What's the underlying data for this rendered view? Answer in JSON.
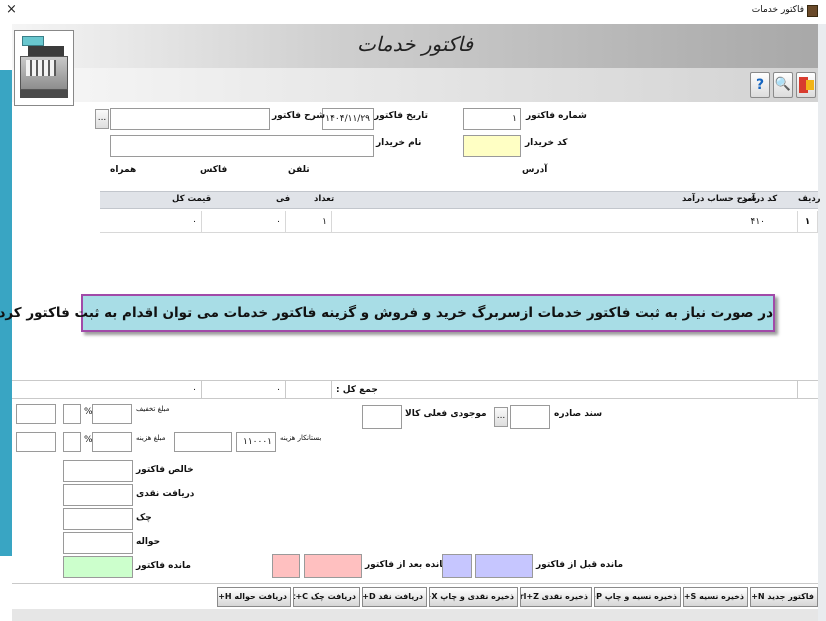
{
  "window": {
    "title": "فاکتور خدمات",
    "close_glyph": "×"
  },
  "header": {
    "title": "فاکتور خدمات"
  },
  "toolbar": {
    "help_glyph": "?",
    "search_glyph": "🔍"
  },
  "form": {
    "invoice_number_label": "شماره فاکتور",
    "invoice_number_value": "۱",
    "invoice_date_label": "تاریخ فاکتور",
    "invoice_date_value": "۱۴۰۴/۱۱/۲۹",
    "invoice_desc_label": "شرح فاکتور",
    "invoice_desc_value": "",
    "buyer_code_label": "کد خریدار",
    "buyer_code_value": "",
    "buyer_name_label": "نام خریدار",
    "buyer_name_value": "",
    "address_label": "آدرس",
    "phone_label": "تلفن",
    "fax_label": "فاکس",
    "mobile_label": "همراه",
    "browse_glyph": "..."
  },
  "grid": {
    "headers": {
      "row": "ردیف",
      "income_code": "کد درآمد",
      "income_desc": "شرح حساب درآمد",
      "qty": "تعداد",
      "unit_price": "فی",
      "total_price": "قیمت کل"
    },
    "rows": [
      {
        "row": "۱",
        "income_code": "۴۱۰",
        "qty": "۱",
        "unit_price": "۰",
        "total_price": "۰"
      }
    ]
  },
  "banner": "در صورت نیاز به ثبت فاکتور خدمات ازسربرگ خرید و فروش و گزینه فاکتور خدمات می توان اقدام به ثبت فاکتور کرد.",
  "totals": {
    "label": "جمع کل :",
    "total_price": "۰",
    "unit_price": "۰"
  },
  "summary": {
    "issued_doc_label": "سند صادره",
    "stock_label": "موجودی فعلی کالا",
    "discount_label": "مبلغ تخفیف",
    "expense_label": "مبلغ هزینه",
    "creditor_label": "بستانکار هزینه",
    "creditor_value": "۱۱۰۰۰۱",
    "percent_sign": "%",
    "net_invoice_label": "خالص فاکتور",
    "cash_received_label": "دریافت نقدی",
    "cheque_label": "چک",
    "draft_label": "حواله",
    "invoice_balance_label": "مانده فاکتور",
    "balance_after_label": "مانده بعد از فاکتور",
    "balance_before_label": "مانده قبل از فاکتور"
  },
  "buttons": {
    "new_invoice": "فاکتور جدید Ctrl+N",
    "save_credit": "ذخیره نسیه Ctrl+S",
    "save_credit_print": "ذخیره نسیه و چاپ Ctrl+P",
    "save_cash": "ذخیره نقدی Ctrl+Z",
    "save_cash_print": "ذخیره نقدی و چاپ Ctrl+X",
    "receive_cash": "دریافت نقد Alt+D",
    "receive_cheque": "دریافت چک Alt+C",
    "receive_draft": "دریافت حواله Alt+H"
  },
  "colors": {
    "accent_strip": "#39a5c3",
    "banner_bg": "#a8dde6",
    "banner_border": "#a14aa8",
    "buyer_code_bg": "#ffffc4",
    "invoice_balance_bg": "#ccffcc",
    "balance_after_bg": "#ffc0c0",
    "balance_before_bg": "#c6c6ff"
  }
}
